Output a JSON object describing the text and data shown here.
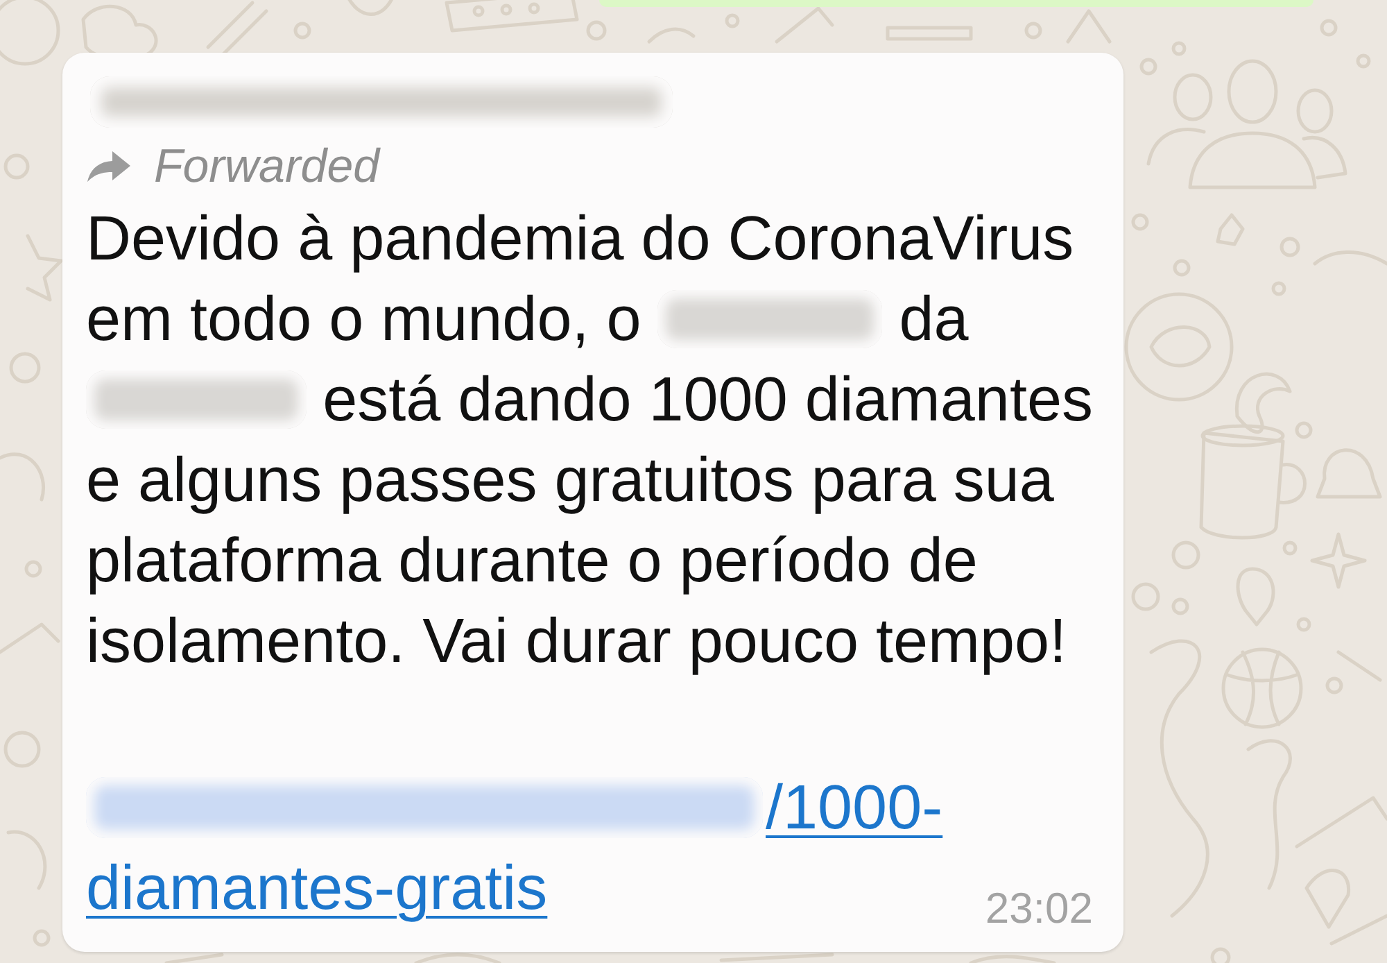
{
  "chat": {
    "previous_message": {
      "kind": "outgoing"
    },
    "message": {
      "sender": {
        "kind": "redacted"
      },
      "forwarded": true,
      "forwarded_label": "Forwarded",
      "paragraphs": [
        [
          [
            {
              "kind": "text",
              "text": "Devido à pandemia do CoronaVirus"
            }
          ],
          [
            {
              "kind": "text",
              "text": "em todo o mundo, o"
            },
            {
              "kind": "redacted"
            },
            {
              "kind": "text",
              "text": "da"
            }
          ],
          [
            {
              "kind": "redacted"
            },
            {
              "kind": "text",
              "text": "está dando 1000 diamantes"
            }
          ],
          [
            {
              "kind": "text",
              "text": "e alguns passes gratuitos para sua"
            }
          ],
          [
            {
              "kind": "text",
              "text": "plataforma durante o período de"
            }
          ],
          [
            {
              "kind": "text",
              "text": "isolamento. Vai durar pouco tempo!"
            }
          ]
        ],
        [
          [
            {
              "kind": "redacted_link"
            },
            {
              "kind": "link",
              "text": "/1000-"
            }
          ],
          [
            {
              "kind": "link",
              "text": "diamantes-gratis"
            }
          ]
        ]
      ],
      "time": "23:02"
    }
  }
}
